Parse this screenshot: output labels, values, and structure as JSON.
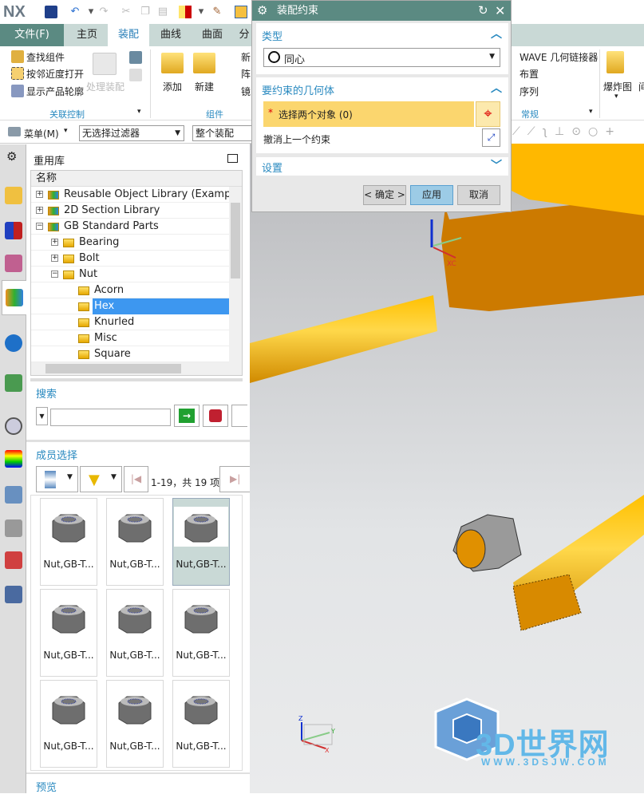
{
  "app": {
    "logo": "NX"
  },
  "ribbon": {
    "tabs": [
      "文件(F)",
      "主页",
      "装配",
      "曲线",
      "曲面",
      "分"
    ],
    "active_tab": "装配",
    "assoc": {
      "items": [
        "查找组件",
        "按邻近度打开",
        "显示产品轮廓"
      ],
      "process": "处理装配",
      "group": "关联控制"
    },
    "component": {
      "add": "添加",
      "new": "新建",
      "items": [
        "新",
        "阵",
        "镜"
      ],
      "group": "组件"
    },
    "general": {
      "items": [
        "WAVE 几何链接器",
        "布置",
        "序列"
      ],
      "group": "常规"
    },
    "explode": "爆炸图",
    "more": "间"
  },
  "selbar": {
    "menu": "菜单(M)",
    "filter": "无选择过滤器",
    "scope": "整个装配"
  },
  "panel": {
    "title": "重用库",
    "tree_header": "名称",
    "tree": [
      {
        "label": "Reusable Object Library (Example C",
        "level": 0,
        "toggle": "+"
      },
      {
        "label": "2D Section Library",
        "level": 0,
        "toggle": "+"
      },
      {
        "label": "GB Standard Parts",
        "level": 0,
        "toggle": "-"
      },
      {
        "label": "Bearing",
        "level": 1,
        "toggle": "+"
      },
      {
        "label": "Bolt",
        "level": 1,
        "toggle": "+"
      },
      {
        "label": "Nut",
        "level": 1,
        "toggle": "-"
      },
      {
        "label": "Acorn",
        "level": 2
      },
      {
        "label": "Hex",
        "level": 2,
        "selected": true
      },
      {
        "label": "Knurled",
        "level": 2
      },
      {
        "label": "Misc",
        "level": 2
      },
      {
        "label": "Square",
        "level": 2
      }
    ],
    "search": {
      "title": "搜索",
      "value": ""
    },
    "members": {
      "title": "成员选择",
      "range": "1-19，共 19 项",
      "tiles": [
        "Nut,GB-T...",
        "Nut,GB-T...",
        "Nut,GB-T...",
        "Nut,GB-T...",
        "Nut,GB-T...",
        "Nut,GB-T...",
        "Nut,GB-T...",
        "Nut,GB-T...",
        "Nut,GB-T..."
      ],
      "selected_tile": 2
    },
    "preview": "预览"
  },
  "dialog": {
    "title": "装配约束",
    "type_section": "类型",
    "type_value": "同心",
    "geom_section": "要约束的几何体",
    "select_prompt": "选择两个对象 (0)",
    "undo_last": "撤消上一个约束",
    "settings": "设置",
    "ok": "< 确定 >",
    "apply": "应用",
    "cancel": "取消"
  },
  "viewport": {
    "csys": {
      "xc": "XC",
      "yc": "YC"
    },
    "triad": {
      "x": "X",
      "y": "Y",
      "z": "Z"
    },
    "watermark": "3D世界网",
    "watermark_url": "WWW.3DSJW.COM"
  },
  "colors": {
    "accent": "#5b8a82",
    "link": "#2a8ac0",
    "part": "#f0a000",
    "select": "#fbd66e"
  }
}
